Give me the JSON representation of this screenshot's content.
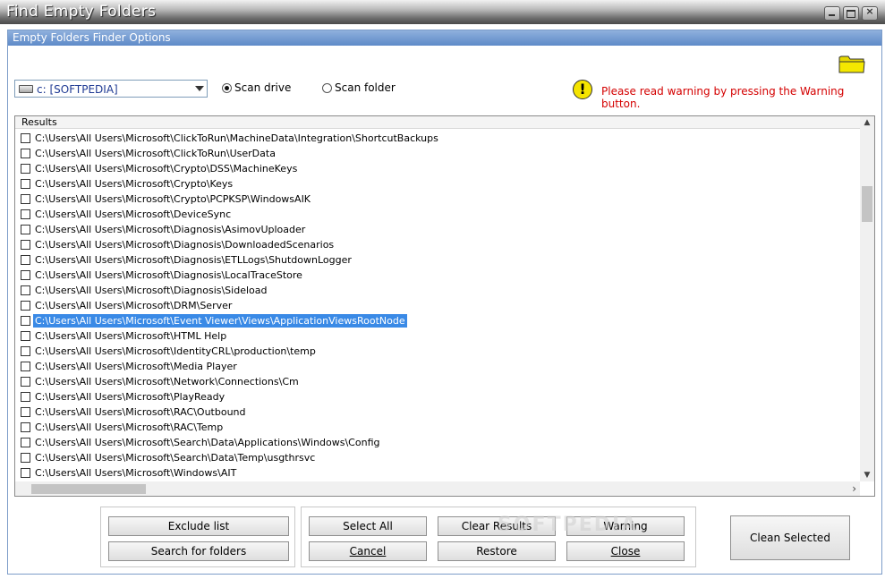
{
  "window": {
    "title": "Find Empty Folders"
  },
  "panel": {
    "title": "Empty Folders Finder Options"
  },
  "drive_select": {
    "value": "c: [SOFTPEDIA]"
  },
  "scan": {
    "drive_label": "Scan drive",
    "folder_label": "Scan folder",
    "selected": "drive"
  },
  "warning": {
    "text": "Please read warning by pressing the Warning button."
  },
  "results": {
    "header": "Results",
    "selected_index": 12,
    "items": [
      "C:\\Users\\All Users\\Microsoft\\ClickToRun\\MachineData\\Integration\\ShortcutBackups",
      "C:\\Users\\All Users\\Microsoft\\ClickToRun\\UserData",
      "C:\\Users\\All Users\\Microsoft\\Crypto\\DSS\\MachineKeys",
      "C:\\Users\\All Users\\Microsoft\\Crypto\\Keys",
      "C:\\Users\\All Users\\Microsoft\\Crypto\\PCPKSP\\WindowsAIK",
      "C:\\Users\\All Users\\Microsoft\\DeviceSync",
      "C:\\Users\\All Users\\Microsoft\\Diagnosis\\AsimovUploader",
      "C:\\Users\\All Users\\Microsoft\\Diagnosis\\DownloadedScenarios",
      "C:\\Users\\All Users\\Microsoft\\Diagnosis\\ETLLogs\\ShutdownLogger",
      "C:\\Users\\All Users\\Microsoft\\Diagnosis\\LocalTraceStore",
      "C:\\Users\\All Users\\Microsoft\\Diagnosis\\Sideload",
      "C:\\Users\\All Users\\Microsoft\\DRM\\Server",
      "C:\\Users\\All Users\\Microsoft\\Event Viewer\\Views\\ApplicationViewsRootNode",
      "C:\\Users\\All Users\\Microsoft\\HTML Help",
      "C:\\Users\\All Users\\Microsoft\\IdentityCRL\\production\\temp",
      "C:\\Users\\All Users\\Microsoft\\Media Player",
      "C:\\Users\\All Users\\Microsoft\\Network\\Connections\\Cm",
      "C:\\Users\\All Users\\Microsoft\\PlayReady",
      "C:\\Users\\All Users\\Microsoft\\RAC\\Outbound",
      "C:\\Users\\All Users\\Microsoft\\RAC\\Temp",
      "C:\\Users\\All Users\\Microsoft\\Search\\Data\\Applications\\Windows\\Config",
      "C:\\Users\\All Users\\Microsoft\\Search\\Data\\Temp\\usgthrsvc",
      "C:\\Users\\All Users\\Microsoft\\Windows\\AIT"
    ]
  },
  "buttons": {
    "exclude_list": "Exclude list",
    "search_for_folders": "Search for folders",
    "select_all": "Select All",
    "cancel": "Cancel",
    "clear_results": "Clear Results",
    "restore": "Restore",
    "warning": "Warning",
    "close": "Close",
    "clean_selected": "Clean Selected"
  },
  "watermark": "SOFTPEDIA",
  "colors": {
    "selection": "#3a8ae6",
    "warning_text": "#d40000",
    "header_blue": "#5e8ac8"
  },
  "icons": {
    "folder": "folder-icon",
    "warning": "exclamation-icon",
    "drive": "drive-icon"
  }
}
